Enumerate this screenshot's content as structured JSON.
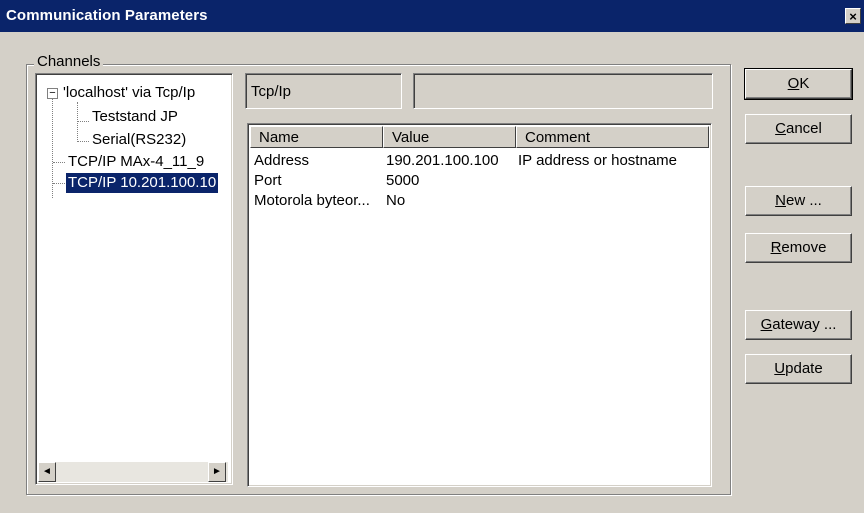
{
  "window": {
    "title": "Communication Parameters",
    "close_glyph": "×"
  },
  "channels": {
    "label": "Channels",
    "tree": [
      {
        "label": "'localhost' via Tcp/Ip",
        "level": 0,
        "expander": "−"
      },
      {
        "label": "Teststand JP",
        "level": 1
      },
      {
        "label": "Serial(RS232)",
        "level": 1
      },
      {
        "label": "TCP/IP MAx-4_11_9",
        "level": 0
      },
      {
        "label": "TCP/IP 10.201.100.10",
        "level": 0,
        "selected": true
      }
    ],
    "scroll_left": "◄",
    "scroll_right": "►"
  },
  "driver": {
    "name": "Tcp/Ip",
    "description": ""
  },
  "table": {
    "columns": [
      "Name",
      "Value",
      "Comment"
    ],
    "rows": [
      {
        "name": "Address",
        "value": "190.201.100.100",
        "comment": "IP address or hostname"
      },
      {
        "name": "Port",
        "value": "5000",
        "comment": ""
      },
      {
        "name": "Motorola byteor...",
        "value": "No",
        "comment": ""
      }
    ]
  },
  "buttons": {
    "ok": "OK",
    "cancel": "Cancel",
    "new": "New ...",
    "remove": "Remove",
    "gateway": "Gateway ...",
    "update": "Update"
  },
  "colors": {
    "titlebar": "#0a246a",
    "face": "#d4d0c8",
    "selection": "#0a246a"
  }
}
